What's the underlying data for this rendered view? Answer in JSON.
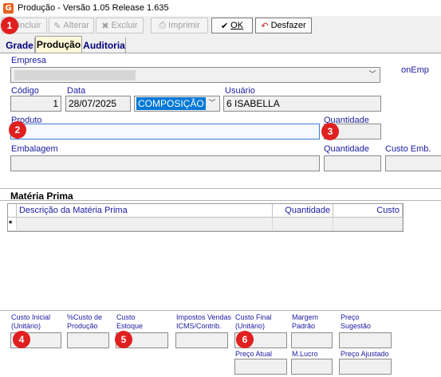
{
  "window": {
    "icon_letter": "G",
    "title": "Produção - Versão 1.05 Release 1.635"
  },
  "toolbar": {
    "incluir": "Incluir",
    "alterar": "Alterar",
    "excluir": "Excluir",
    "imprimir": "Imprimir",
    "ok": "OK",
    "desfazer": "Desfazer",
    "icons": {
      "incluir": "plus-icon",
      "alterar": "edit-icon",
      "excluir": "delete-icon",
      "imprimir": "printer-icon",
      "ok": "check-icon",
      "desfazer": "undo-icon"
    }
  },
  "tabs": [
    "Grade",
    "Produção",
    "Auditoria"
  ],
  "form": {
    "empresa_label": "Empresa",
    "empresa_value": "",
    "trailing_label": "onEmp",
    "codigo_label": "Código",
    "codigo_value": "1",
    "data_label": "Data",
    "data_value": "28/07/2025",
    "tipo_value": "COMPOSIÇÃO",
    "usuario_label": "Usuário",
    "usuario_value": "6 ISABELLA",
    "produto_label": "Produto",
    "produto_value": "",
    "quantidade_label": "Quantidade",
    "quantidade_value": "",
    "embalagem_label": "Embalagem",
    "embalagem_value": "",
    "quantidade2_label": "Quantidade",
    "custo_emb_label": "Custo Emb."
  },
  "materia_prima": {
    "title": "Matéria Prima",
    "columns": [
      "Descrição da Matéria Prima",
      "Quantidade",
      "Custo"
    ],
    "new_row_marker": "*"
  },
  "costs": {
    "custo_inicial": "Custo Inicial (Unitário)",
    "pct_custo": "%Custo de Produção",
    "custo_estoque": "Custo Estoque",
    "impostos": "Impostos Vendas ICMS/Contrib.",
    "custo_final": "Custo Final (Unitário)",
    "margem_padrao": "Margem Padrão",
    "preco_sugestao": "Preço Sugestão",
    "preco_atual": "Preço Atual",
    "m_lucro": "M.Lucro",
    "preco_ajustado": "Preço Ajustado"
  },
  "markers": [
    "1",
    "2",
    "3",
    "4",
    "5",
    "6"
  ],
  "colors": {
    "label_blue": "#1a1aa0",
    "marker_red": "#e02020",
    "selection_blue": "#0078d7",
    "tab_active_bg": "#fff8d8"
  }
}
